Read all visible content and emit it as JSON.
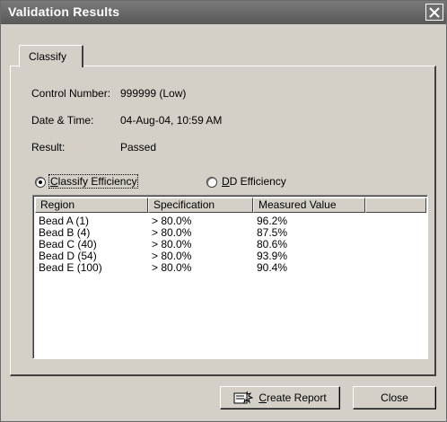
{
  "window": {
    "title": "Validation Results"
  },
  "tabs": [
    {
      "label": "Classify"
    }
  ],
  "info": {
    "control_number_label": "Control Number:",
    "control_number_value": "999999 (Low)",
    "datetime_label": "Date & Time:",
    "datetime_value": "04-Aug-04, 10:59 AM",
    "result_label": "Result:",
    "result_value": "Passed"
  },
  "radios": [
    {
      "label": "Classify Efficiency",
      "selected": true
    },
    {
      "label": "DD Efficiency",
      "selected": false
    }
  ],
  "table": {
    "columns": [
      "Region",
      "Specification",
      "Measured Value"
    ],
    "rows": [
      [
        "Bead A (1)",
        "> 80.0%",
        "96.2%"
      ],
      [
        "Bead B (4)",
        "> 80.0%",
        "87.5%"
      ],
      [
        "Bead C (40)",
        "> 80.0%",
        "80.6%"
      ],
      [
        "Bead D (54)",
        "> 80.0%",
        "93.9%"
      ],
      [
        "Bead E (100)",
        "> 80.0%",
        "90.4%"
      ]
    ]
  },
  "buttons": {
    "create_report": "Create Report",
    "close": "Close"
  },
  "icons": {
    "close": "close-x-icon",
    "report": "report-icon"
  }
}
